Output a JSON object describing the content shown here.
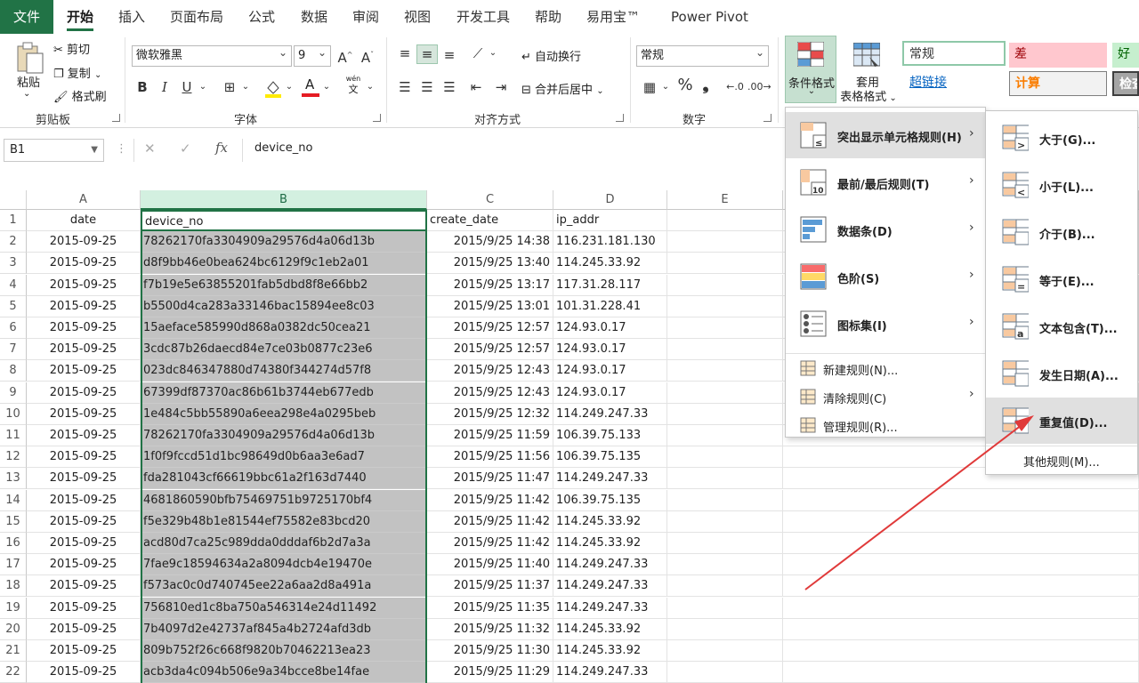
{
  "tabs": [
    "文件",
    "开始",
    "插入",
    "页面布局",
    "公式",
    "数据",
    "审阅",
    "视图",
    "开发工具",
    "帮助",
    "易用宝™",
    "Power Pivot"
  ],
  "clipboard": {
    "paste": "粘贴",
    "cut": "剪切",
    "copy": "复制",
    "format_painter": "格式刷",
    "label": "剪贴板"
  },
  "font": {
    "name": "微软雅黑",
    "size": "9",
    "grow": "A^",
    "shrink": "Aˇ",
    "bold": "B",
    "italic": "I",
    "underline": "U",
    "color_letter": "A",
    "phonetic_top": "wén",
    "phonetic_bottom": "文",
    "label": "字体"
  },
  "alignment": {
    "wrap": "自动换行",
    "merge": "合并后居中",
    "label": "对齐方式"
  },
  "number": {
    "format": "常规",
    "percent": "%",
    "comma": "❟",
    "label": "数字"
  },
  "styles": {
    "conditional": "条件格式",
    "table_format_top": "套用",
    "table_format_bottom": "表格格式",
    "normal": "常规",
    "bad": "差",
    "good": "好",
    "hyperlink": "超链接",
    "calc": "计算",
    "check": "检查"
  },
  "formula_bar": {
    "name_box": "B1",
    "fx": "fx",
    "value": "device_no",
    "cancel": "✕",
    "enter": "✓"
  },
  "columns": [
    "A",
    "B",
    "C",
    "D",
    "E"
  ],
  "rows": [
    [
      "date",
      "device_no",
      "create_date",
      "ip_addr"
    ],
    [
      "2015-09-25",
      "78262170fa3304909a29576d4a06d13b",
      "2015/9/25 14:38",
      "116.231.181.130"
    ],
    [
      "2015-09-25",
      "d8f9bb46e0bea624bc6129f9c1eb2a01",
      "2015/9/25 13:40",
      "114.245.33.92"
    ],
    [
      "2015-09-25",
      "f7b19e5e63855201fab5dbd8f8e66bb2",
      "2015/9/25 13:17",
      "117.31.28.117"
    ],
    [
      "2015-09-25",
      "b5500d4ca283a33146bac15894ee8c03",
      "2015/9/25 13:01",
      "101.31.228.41"
    ],
    [
      "2015-09-25",
      "15aeface585990d868a0382dc50cea21",
      "2015/9/25 12:57",
      "124.93.0.17"
    ],
    [
      "2015-09-25",
      "3cdc87b26daecd84e7ce03b0877c23e6",
      "2015/9/25 12:57",
      "124.93.0.17"
    ],
    [
      "2015-09-25",
      "023dc846347880d74380f344274d57f8",
      "2015/9/25 12:43",
      "124.93.0.17"
    ],
    [
      "2015-09-25",
      "67399df87370ac86b61b3744eb677edb",
      "2015/9/25 12:43",
      "124.93.0.17"
    ],
    [
      "2015-09-25",
      "1e484c5bb55890a6eea298e4a0295beb",
      "2015/9/25 12:32",
      "114.249.247.33"
    ],
    [
      "2015-09-25",
      "78262170fa3304909a29576d4a06d13b",
      "2015/9/25 11:59",
      "106.39.75.133"
    ],
    [
      "2015-09-25",
      "1f0f9fccd51d1bc98649d0b6aa3e6ad7",
      "2015/9/25 11:56",
      "106.39.75.135"
    ],
    [
      "2015-09-25",
      "fda281043cf66619bbc61a2f163d7440",
      "2015/9/25 11:47",
      "114.249.247.33"
    ],
    [
      "2015-09-25",
      "4681860590bfb75469751b9725170bf4",
      "2015/9/25 11:42",
      "106.39.75.135"
    ],
    [
      "2015-09-25",
      "f5e329b48b1e81544ef75582e83bcd20",
      "2015/9/25 11:42",
      "114.245.33.92"
    ],
    [
      "2015-09-25",
      "acd80d7ca25c989dda0dddaf6b2d7a3a",
      "2015/9/25 11:42",
      "114.245.33.92"
    ],
    [
      "2015-09-25",
      "7fae9c18594634a2a8094dcb4e19470e",
      "2015/9/25 11:40",
      "114.249.247.33"
    ],
    [
      "2015-09-25",
      "f573ac0c0d740745ee22a6aa2d8a491a",
      "2015/9/25 11:37",
      "114.249.247.33"
    ],
    [
      "2015-09-25",
      "756810ed1c8ba750a546314e24d11492",
      "2015/9/25 11:35",
      "114.249.247.33"
    ],
    [
      "2015-09-25",
      "7b4097d2e42737af845a4b2724afd3db",
      "2015/9/25 11:32",
      "114.245.33.92"
    ],
    [
      "2015-09-25",
      "809b752f26c668f9820b70462213ea23",
      "2015/9/25 11:30",
      "114.245.33.92"
    ],
    [
      "2015-09-25",
      "acb3da4c094b506e9a34bcce8be14fae",
      "2015/9/25 11:29",
      "114.249.247.33"
    ]
  ],
  "cf_menu": [
    {
      "label": "突出显示单元格规则(H)",
      "icon": "highlight-rules-icon",
      "sub": true,
      "hl": true
    },
    {
      "label": "最前/最后规则(T)",
      "icon": "top-bottom-icon",
      "sub": true
    },
    {
      "label": "数据条(D)",
      "icon": "data-bars-icon",
      "sub": true
    },
    {
      "label": "色阶(S)",
      "icon": "color-scales-icon",
      "sub": true
    },
    {
      "label": "图标集(I)",
      "icon": "icon-sets-icon",
      "sub": true
    }
  ],
  "cf_menu_small": [
    {
      "label": "新建规则(N)...",
      "icon": "new-rule-icon",
      "sub": false
    },
    {
      "label": "清除规则(C)",
      "icon": "clear-rules-icon",
      "sub": true
    },
    {
      "label": "管理规则(R)...",
      "icon": "manage-rules-icon",
      "sub": false
    }
  ],
  "submenu": [
    {
      "label": "大于(G)...",
      "glyph": ">"
    },
    {
      "label": "小于(L)...",
      "glyph": "<"
    },
    {
      "label": "介于(B)...",
      "glyph": ""
    },
    {
      "label": "等于(E)...",
      "glyph": "="
    },
    {
      "label": "文本包含(T)...",
      "glyph": "a"
    },
    {
      "label": "发生日期(A)...",
      "glyph": ""
    },
    {
      "label": "重复值(D)...",
      "glyph": "",
      "hl": true
    }
  ],
  "submenu_more": "其他规则(M)...",
  "colors": {
    "excel_green": "#217346",
    "selection_gray": "#c2c2c2",
    "arrow": "#e03a3a"
  }
}
